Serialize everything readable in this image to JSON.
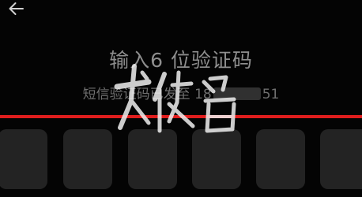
{
  "header": {
    "back_icon": "arrow-left-icon"
  },
  "verification": {
    "title": "输入6 位验证码",
    "subtitle_prefix": "短信验证码已发至",
    "phone_start": "18",
    "phone_end": "51"
  },
  "code_input": {
    "box_count": 6,
    "digits": [
      "",
      "",
      "",
      "",
      "",
      ""
    ]
  },
  "watermark": {
    "text": "龙侠谷"
  },
  "colors": {
    "background": "#040404",
    "accent_line": "#e01d1d",
    "box": "#232323",
    "title_text": "#8e8e8e",
    "subtitle_text": "#6f6f6f"
  }
}
